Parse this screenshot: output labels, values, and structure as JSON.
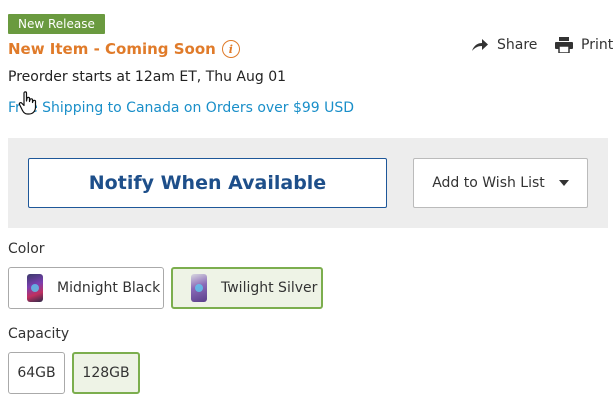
{
  "badge": "New Release",
  "title": "New Item - Coming Soon",
  "info_icon_glyph": "i",
  "actions": {
    "share": "Share",
    "print": "Print"
  },
  "preorder": "Preorder starts at 12am ET, Thu Aug 01",
  "shipping": "Free Shipping to Canada on Orders over $99 USD",
  "buttons": {
    "notify": "Notify When Available",
    "wishlist": "Add to Wish List"
  },
  "color": {
    "label": "Color",
    "options": [
      {
        "label": "Midnight Black",
        "selected": false
      },
      {
        "label": "Twilight Silver",
        "selected": true
      }
    ]
  },
  "capacity": {
    "label": "Capacity",
    "options": [
      {
        "label": "64GB",
        "selected": false
      },
      {
        "label": "128GB",
        "selected": true
      }
    ]
  },
  "colors": {
    "badge": "#6a9a3f",
    "title": "#e07b2a",
    "link": "#1a8fc9",
    "notify": "#1e4f8a",
    "selected_border": "#7cae4e"
  }
}
